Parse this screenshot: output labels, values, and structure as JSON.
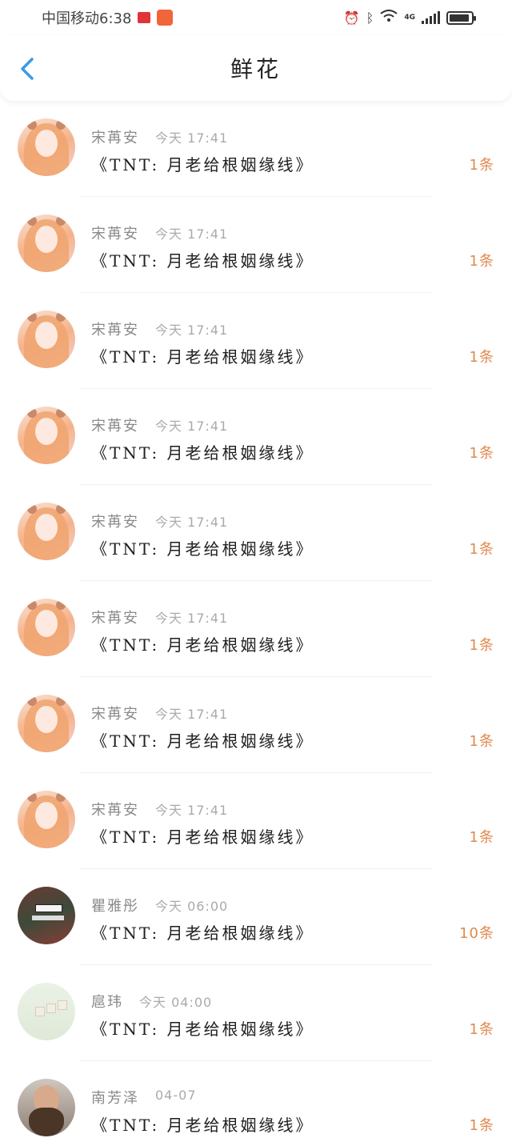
{
  "status_bar": {
    "carrier_time": "中国移动6:38",
    "network": "4G"
  },
  "header": {
    "title": "鲜花"
  },
  "items": [
    {
      "sender": "宋苒安",
      "time": "今天 17:41",
      "message": "《TNT: 月老给根姻缘线》",
      "count": "1条",
      "avatar": "girl"
    },
    {
      "sender": "宋苒安",
      "time": "今天 17:41",
      "message": "《TNT: 月老给根姻缘线》",
      "count": "1条",
      "avatar": "girl"
    },
    {
      "sender": "宋苒安",
      "time": "今天 17:41",
      "message": "《TNT: 月老给根姻缘线》",
      "count": "1条",
      "avatar": "girl"
    },
    {
      "sender": "宋苒安",
      "time": "今天 17:41",
      "message": "《TNT: 月老给根姻缘线》",
      "count": "1条",
      "avatar": "girl"
    },
    {
      "sender": "宋苒安",
      "time": "今天 17:41",
      "message": "《TNT: 月老给根姻缘线》",
      "count": "1条",
      "avatar": "girl"
    },
    {
      "sender": "宋苒安",
      "time": "今天 17:41",
      "message": "《TNT: 月老给根姻缘线》",
      "count": "1条",
      "avatar": "girl"
    },
    {
      "sender": "宋苒安",
      "time": "今天 17:41",
      "message": "《TNT: 月老给根姻缘线》",
      "count": "1条",
      "avatar": "girl"
    },
    {
      "sender": "宋苒安",
      "time": "今天 17:41",
      "message": "《TNT: 月老给根姻缘线》",
      "count": "1条",
      "avatar": "girl"
    },
    {
      "sender": "瞿雅彤",
      "time": "今天 06:00",
      "message": "《TNT: 月老给根姻缘线》",
      "count": "10条",
      "avatar": "street"
    },
    {
      "sender": "扈玮",
      "time": "今天 04:00",
      "message": "《TNT: 月老给根姻缘线》",
      "count": "1条",
      "avatar": "love"
    },
    {
      "sender": "南芳泽",
      "time": "04-07",
      "message": "《TNT: 月老给根姻缘线》",
      "count": "1条",
      "avatar": "beard"
    }
  ],
  "colors": {
    "accent_blue": "#3a9ae8",
    "count_orange": "#e08a4c"
  }
}
